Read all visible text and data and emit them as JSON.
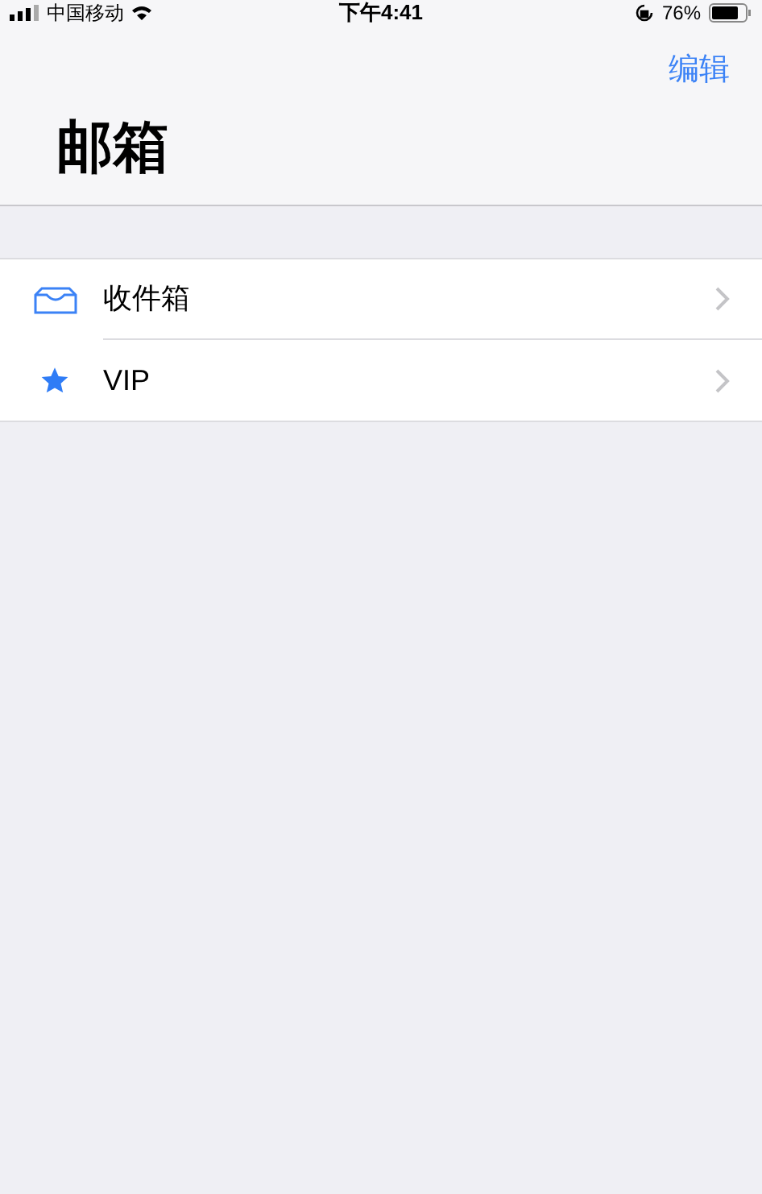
{
  "status_bar": {
    "carrier": "中国移动",
    "time": "下午4:41",
    "battery": "76%"
  },
  "nav": {
    "edit": "编辑",
    "title": "邮箱"
  },
  "mailboxes": [
    {
      "kind": "inbox",
      "label": "收件箱"
    },
    {
      "kind": "star",
      "label": "VIP"
    }
  ]
}
